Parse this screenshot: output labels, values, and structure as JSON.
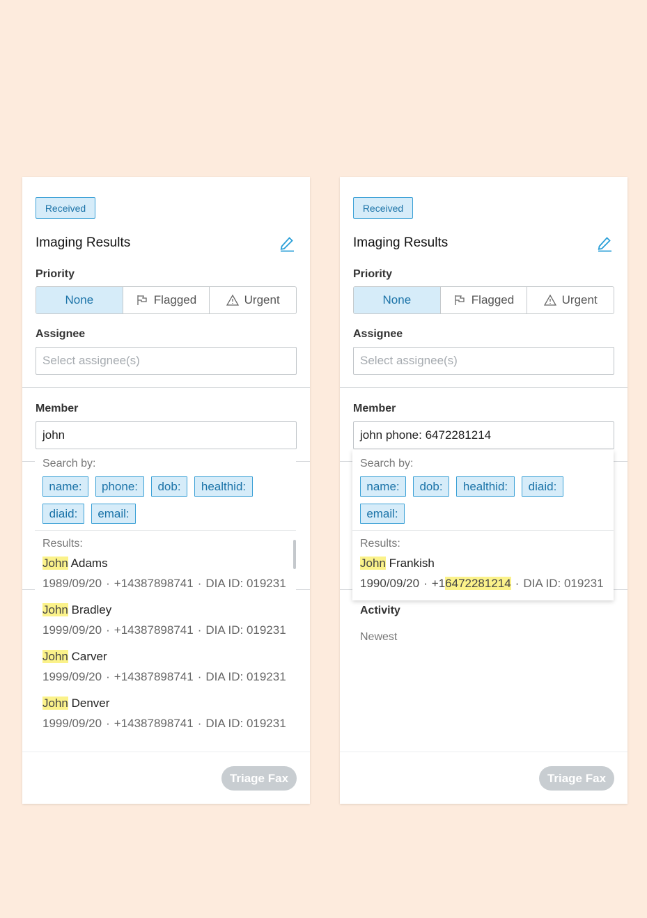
{
  "panels": [
    {
      "status_badge": "Received",
      "title": "Imaging Results",
      "priority_label": "Priority",
      "priority_options": [
        "None",
        "Flagged",
        "Urgent"
      ],
      "assignee_label": "Assignee",
      "assignee_placeholder": "Select assignee(s)",
      "member_label": "Member",
      "member_value": "john",
      "search_by_label": "Search by:",
      "chips": [
        "name:",
        "phone:",
        "dob:",
        "healthid:",
        "diaid:",
        "email:"
      ],
      "results_label": "Results:",
      "results": [
        {
          "first": "John",
          "last": "Adams",
          "dob": "1989/09/20",
          "phone": "+14387898741",
          "dia": "DIA ID: 019231"
        },
        {
          "first": "John",
          "last": "Bradley",
          "dob": "1999/09/20",
          "phone": "+14387898741",
          "dia": "DIA ID: 019231"
        },
        {
          "first": "John",
          "last": "Carver",
          "dob": "1999/09/20",
          "phone": "+14387898741",
          "dia": "DIA ID: 019231"
        },
        {
          "first": "John",
          "last": "Denver",
          "dob": "1999/09/20",
          "phone": "+14387898741",
          "dia": "DIA ID: 019231"
        }
      ],
      "triage_button": "Triage Fax"
    },
    {
      "status_badge": "Received",
      "title": "Imaging Results",
      "priority_label": "Priority",
      "priority_options": [
        "None",
        "Flagged",
        "Urgent"
      ],
      "assignee_label": "Assignee",
      "assignee_placeholder": "Select assignee(s)",
      "member_label": "Member",
      "member_value": "john phone: 6472281214",
      "search_by_label": "Search by:",
      "chips": [
        "name:",
        "dob:",
        "healthid:",
        "diaid:",
        "email:"
      ],
      "results_label": "Results:",
      "results": [
        {
          "first": "John",
          "last": "Frankish",
          "dob": "1990/09/20",
          "phone_prefix": "+1",
          "phone_match": "6472281214",
          "dia": "DIA ID: 019231"
        }
      ],
      "activity_label": "Activity",
      "activity_sort": "Newest",
      "triage_button": "Triage Fax"
    }
  ],
  "colors": {
    "background": "#fdebdd",
    "accent": "#1b73a8",
    "highlight": "#fbf28a",
    "chip_bg": "#d6ecf9"
  },
  "icons": [
    "edit-pencil-icon",
    "flag-icon",
    "warning-triangle-icon"
  ]
}
